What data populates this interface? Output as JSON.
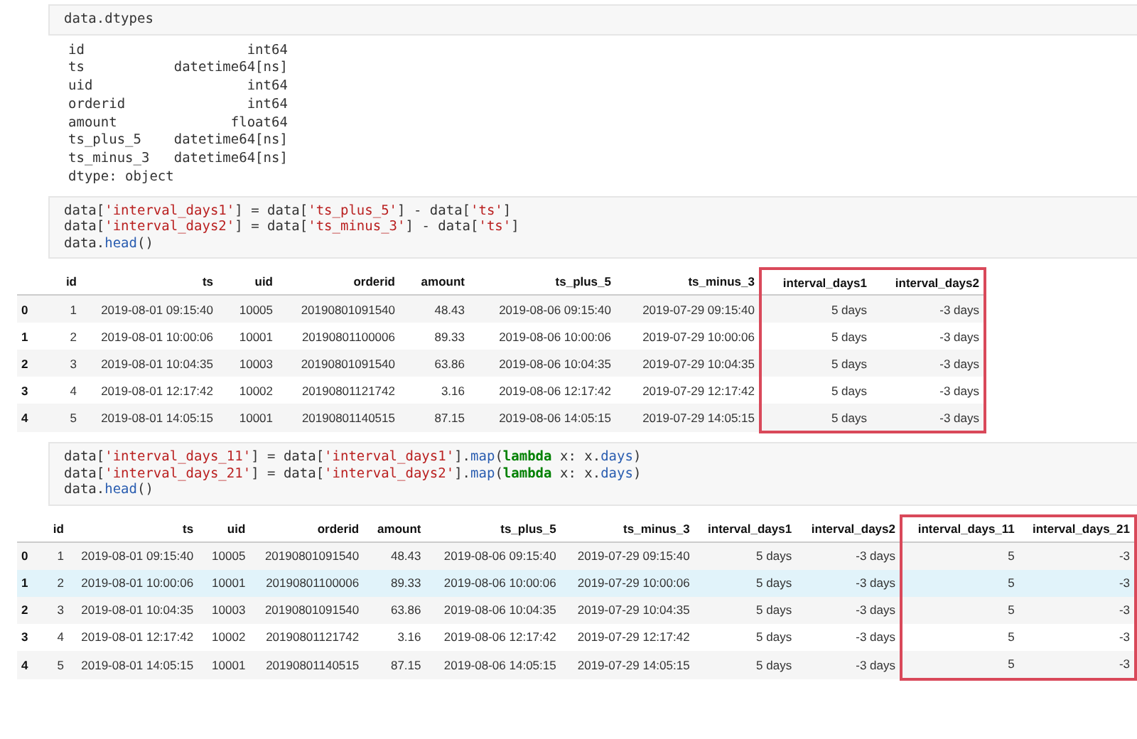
{
  "cells": [
    {
      "kind": "code",
      "lines": [
        [
          {
            "text": "data.dtypes",
            "kind": "plain"
          }
        ]
      ]
    },
    {
      "kind": "text_output",
      "lines": [
        "id                    int64",
        "ts           datetime64[ns]",
        "uid                   int64",
        "orderid               int64",
        "amount              float64",
        "ts_plus_5    datetime64[ns]",
        "ts_minus_3   datetime64[ns]",
        "dtype: object"
      ]
    },
    {
      "kind": "code",
      "lines": [
        [
          {
            "text": "data[",
            "kind": "plain"
          },
          {
            "text": "'interval_days1'",
            "kind": "string"
          },
          {
            "text": "] = data[",
            "kind": "plain"
          },
          {
            "text": "'ts_plus_5'",
            "kind": "string"
          },
          {
            "text": "] - data[",
            "kind": "plain"
          },
          {
            "text": "'ts'",
            "kind": "string"
          },
          {
            "text": "]",
            "kind": "plain"
          }
        ],
        [
          {
            "text": "data[",
            "kind": "plain"
          },
          {
            "text": "'interval_days2'",
            "kind": "string"
          },
          {
            "text": "] = data[",
            "kind": "plain"
          },
          {
            "text": "'ts_minus_3'",
            "kind": "string"
          },
          {
            "text": "] - data[",
            "kind": "plain"
          },
          {
            "text": "'ts'",
            "kind": "string"
          },
          {
            "text": "]",
            "kind": "plain"
          }
        ],
        [
          {
            "text": "data.",
            "kind": "plain"
          },
          {
            "text": "head",
            "kind": "call"
          },
          {
            "text": "()",
            "kind": "plain"
          }
        ]
      ]
    },
    {
      "kind": "table",
      "columns": [
        {
          "outlined": false
        },
        {
          "label": "id",
          "outlined": false
        },
        {
          "label": "ts",
          "outlined": false
        },
        {
          "label": "uid",
          "outlined": false
        },
        {
          "label": "orderid",
          "outlined": false
        },
        {
          "label": "amount",
          "outlined": false
        },
        {
          "label": "ts_plus_5",
          "outlined": false
        },
        {
          "label": "ts_minus_3",
          "outlined": false
        },
        {
          "label": "interval_days1",
          "outlined": true
        },
        {
          "label": "interval_days2",
          "outlined": true
        }
      ],
      "rows": [
        {
          "selected": false,
          "cells": [
            "0",
            "1",
            "2019-08-01 09:15:40",
            "10005",
            "20190801091540",
            "48.43",
            "2019-08-06 09:15:40",
            "2019-07-29 09:15:40",
            "5 days",
            "-3 days"
          ]
        },
        {
          "selected": false,
          "cells": [
            "1",
            "2",
            "2019-08-01 10:00:06",
            "10001",
            "20190801100006",
            "89.33",
            "2019-08-06 10:00:06",
            "2019-07-29 10:00:06",
            "5 days",
            "-3 days"
          ]
        },
        {
          "selected": false,
          "cells": [
            "2",
            "3",
            "2019-08-01 10:04:35",
            "10003",
            "20190801091540",
            "63.86",
            "2019-08-06 10:04:35",
            "2019-07-29 10:04:35",
            "5 days",
            "-3 days"
          ]
        },
        {
          "selected": false,
          "cells": [
            "3",
            "4",
            "2019-08-01 12:17:42",
            "10002",
            "20190801121742",
            "3.16",
            "2019-08-06 12:17:42",
            "2019-07-29 12:17:42",
            "5 days",
            "-3 days"
          ]
        },
        {
          "selected": false,
          "cells": [
            "4",
            "5",
            "2019-08-01 14:05:15",
            "10001",
            "20190801140515",
            "87.15",
            "2019-08-06 14:05:15",
            "2019-07-29 14:05:15",
            "5 days",
            "-3 days"
          ]
        }
      ]
    },
    {
      "kind": "code",
      "lines": [
        [
          {
            "text": "data[",
            "kind": "plain"
          },
          {
            "text": "'interval_days_11'",
            "kind": "string"
          },
          {
            "text": "] = data[",
            "kind": "plain"
          },
          {
            "text": "'interval_days1'",
            "kind": "string"
          },
          {
            "text": "].",
            "kind": "plain"
          },
          {
            "text": "map",
            "kind": "call"
          },
          {
            "text": "(",
            "kind": "plain"
          },
          {
            "text": "lambda",
            "kind": "keyword"
          },
          {
            "text": " x: x.",
            "kind": "plain"
          },
          {
            "text": "days",
            "kind": "call"
          },
          {
            "text": ")",
            "kind": "plain"
          }
        ],
        [
          {
            "text": "data[",
            "kind": "plain"
          },
          {
            "text": "'interval_days_21'",
            "kind": "string"
          },
          {
            "text": "] = data[",
            "kind": "plain"
          },
          {
            "text": "'interval_days2'",
            "kind": "string"
          },
          {
            "text": "].",
            "kind": "plain"
          },
          {
            "text": "map",
            "kind": "call"
          },
          {
            "text": "(",
            "kind": "plain"
          },
          {
            "text": "lambda",
            "kind": "keyword"
          },
          {
            "text": " x: x.",
            "kind": "plain"
          },
          {
            "text": "days",
            "kind": "call"
          },
          {
            "text": ")",
            "kind": "plain"
          }
        ],
        [
          {
            "text": "data.",
            "kind": "plain"
          },
          {
            "text": "head",
            "kind": "call"
          },
          {
            "text": "()",
            "kind": "plain"
          }
        ]
      ]
    },
    {
      "kind": "table",
      "columns": [
        {
          "outlined": false
        },
        {
          "label": "id",
          "outlined": false
        },
        {
          "label": "ts",
          "outlined": false
        },
        {
          "label": "uid",
          "outlined": false
        },
        {
          "label": "orderid",
          "outlined": false
        },
        {
          "label": "amount",
          "outlined": false
        },
        {
          "label": "ts_plus_5",
          "outlined": false
        },
        {
          "label": "ts_minus_3",
          "outlined": false
        },
        {
          "label": "interval_days1",
          "outlined": false
        },
        {
          "label": "interval_days2",
          "outlined": false
        },
        {
          "label": "interval_days_11",
          "outlined": true
        },
        {
          "label": "interval_days_21",
          "outlined": true
        }
      ],
      "rows": [
        {
          "selected": false,
          "cells": [
            "0",
            "1",
            "2019-08-01 09:15:40",
            "10005",
            "20190801091540",
            "48.43",
            "2019-08-06 09:15:40",
            "2019-07-29 09:15:40",
            "5 days",
            "-3 days",
            "5",
            "-3"
          ]
        },
        {
          "selected": true,
          "cells": [
            "1",
            "2",
            "2019-08-01 10:00:06",
            "10001",
            "20190801100006",
            "89.33",
            "2019-08-06 10:00:06",
            "2019-07-29 10:00:06",
            "5 days",
            "-3 days",
            "5",
            "-3"
          ]
        },
        {
          "selected": false,
          "cells": [
            "2",
            "3",
            "2019-08-01 10:04:35",
            "10003",
            "20190801091540",
            "63.86",
            "2019-08-06 10:04:35",
            "2019-07-29 10:04:35",
            "5 days",
            "-3 days",
            "5",
            "-3"
          ]
        },
        {
          "selected": false,
          "cells": [
            "3",
            "4",
            "2019-08-01 12:17:42",
            "10002",
            "20190801121742",
            "3.16",
            "2019-08-06 12:17:42",
            "2019-07-29 12:17:42",
            "5 days",
            "-3 days",
            "5",
            "-3"
          ]
        },
        {
          "selected": false,
          "cells": [
            "4",
            "5",
            "2019-08-01 14:05:15",
            "10001",
            "20190801140515",
            "87.15",
            "2019-08-06 14:05:15",
            "2019-07-29 14:05:15",
            "5 days",
            "-3 days",
            "5",
            "-3"
          ]
        }
      ]
    }
  ]
}
